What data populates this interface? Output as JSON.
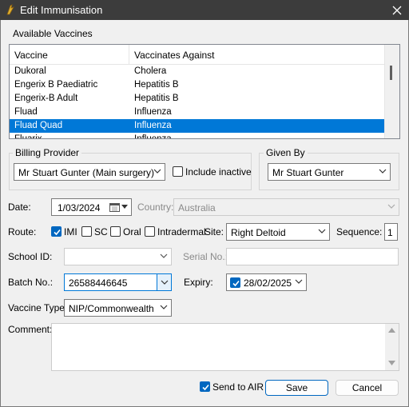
{
  "window": {
    "title": "Edit Immunisation"
  },
  "available_vaccines": {
    "label": "Available Vaccines",
    "columns": [
      "Vaccine",
      "Vaccinates Against"
    ],
    "rows": [
      {
        "vaccine": "Dukoral",
        "against": "Cholera",
        "selected": false
      },
      {
        "vaccine": "Engerix B Paediatric",
        "against": "Hepatitis B",
        "selected": false
      },
      {
        "vaccine": "Engerix-B Adult",
        "against": "Hepatitis B",
        "selected": false
      },
      {
        "vaccine": "Fluad",
        "against": "Influenza",
        "selected": false
      },
      {
        "vaccine": "Fluad Quad",
        "against": "Influenza",
        "selected": true
      },
      {
        "vaccine": "Fluarix",
        "against": "Influenza",
        "selected": false
      }
    ]
  },
  "billing_provider": {
    "label": "Billing Provider",
    "value": "Mr Stuart Gunter (Main surgery)",
    "include_inactive_label": "Include inactive",
    "include_inactive_checked": false
  },
  "given_by": {
    "label": "Given By",
    "value": "Mr Stuart Gunter"
  },
  "date": {
    "label": "Date:",
    "value": "1/03/2024"
  },
  "country": {
    "label": "Country:",
    "value": "Australia"
  },
  "route": {
    "label": "Route:",
    "options": [
      {
        "label": "IMI",
        "checked": true
      },
      {
        "label": "SC",
        "checked": false
      },
      {
        "label": "Oral",
        "checked": false
      },
      {
        "label": "Intradermal",
        "checked": false
      }
    ]
  },
  "site": {
    "label": "Site:",
    "value": "Right Deltoid"
  },
  "sequence": {
    "label": "Sequence:",
    "value": "1"
  },
  "school_id": {
    "label": "School ID:",
    "value": ""
  },
  "serial_no": {
    "label": "Serial No.:",
    "value": ""
  },
  "batch_no": {
    "label": "Batch No.:",
    "value": "26588446645"
  },
  "expiry": {
    "label": "Expiry:",
    "value": "28/02/2025",
    "checked": true
  },
  "vaccine_type": {
    "label": "Vaccine Type:",
    "value": "NIP/Commonwealth"
  },
  "comment": {
    "label": "Comment:",
    "value": ""
  },
  "send_to_air": {
    "label": "Send to AIR",
    "checked": true
  },
  "buttons": {
    "save": "Save",
    "cancel": "Cancel"
  }
}
